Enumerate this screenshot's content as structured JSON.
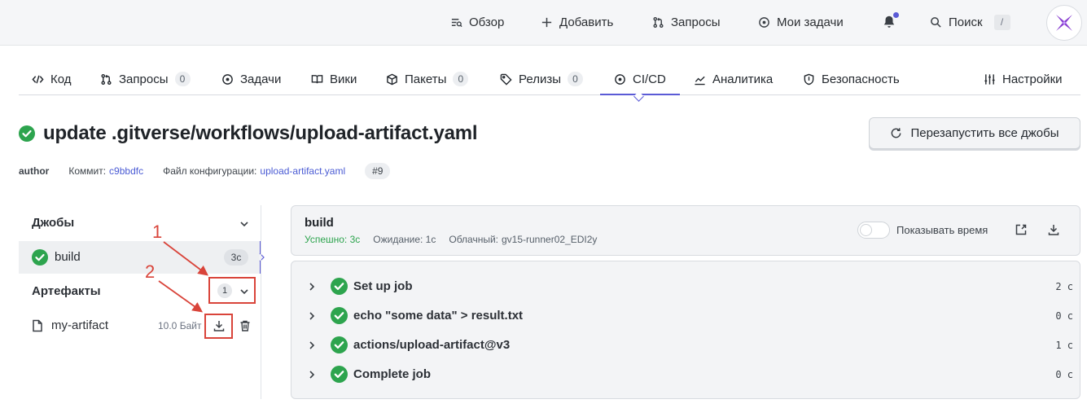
{
  "topnav": {
    "items": [
      {
        "label": "Обзор",
        "icon": "overview-icon"
      },
      {
        "label": "Добавить",
        "icon": "plus-icon"
      },
      {
        "label": "Запросы",
        "icon": "pull-request-icon"
      },
      {
        "label": "Мои задачи",
        "icon": "circle-dot-icon"
      }
    ],
    "search_label": "Поиск",
    "search_shortcut": "/"
  },
  "repo_tabs": [
    {
      "label": "Код",
      "icon": "code-icon"
    },
    {
      "label": "Запросы",
      "count": "0",
      "icon": "pull-request-icon"
    },
    {
      "label": "Задачи",
      "icon": "circle-dot-icon"
    },
    {
      "label": "Вики",
      "icon": "book-icon"
    },
    {
      "label": "Пакеты",
      "count": "0",
      "icon": "package-icon"
    },
    {
      "label": "Релизы",
      "count": "0",
      "icon": "tag-icon"
    },
    {
      "label": "CI/CD",
      "icon": "circle-dot-icon",
      "active": true
    },
    {
      "label": "Аналитика",
      "icon": "chart-icon"
    },
    {
      "label": "Безопасность",
      "icon": "shield-icon"
    },
    {
      "label": "Настройки",
      "icon": "sliders-icon"
    }
  ],
  "run": {
    "title": "update .gitverse/workflows/upload-artifact.yaml",
    "rerun_label": "Перезапустить все джобы",
    "author": "author",
    "commit_label": "Коммит:",
    "commit_hash": "c9bbdfc",
    "config_label": "Файл конфигурации:",
    "config_file": "upload-artifact.yaml",
    "run_number": "#9"
  },
  "sidebar": {
    "jobs_title": "Джобы",
    "job": {
      "name": "build",
      "duration": "3с"
    },
    "artifacts_title": "Артефакты",
    "artifacts_count": "1",
    "artifact": {
      "name": "my-artifact",
      "size": "10.0 Байт"
    }
  },
  "annotations": {
    "one": "1",
    "two": "2"
  },
  "job_panel": {
    "name": "build",
    "status": "Успешно: 3с",
    "wait": "Ожидание: 1с",
    "runner_label": "Облачный:",
    "runner": "gv15-runner02_EDI2y",
    "toggle_label": "Показывать время"
  },
  "steps": [
    {
      "name": "Set up job",
      "time": "2 с"
    },
    {
      "name": "echo \"some data\" > result.txt",
      "time": "0 с"
    },
    {
      "name": "actions/upload-artifact@v3",
      "time": "1 с"
    },
    {
      "name": "Complete job",
      "time": "0 с"
    }
  ],
  "colors": {
    "accent": "#5b5bd6",
    "success": "#2da44e",
    "annotation": "#d9443a"
  }
}
